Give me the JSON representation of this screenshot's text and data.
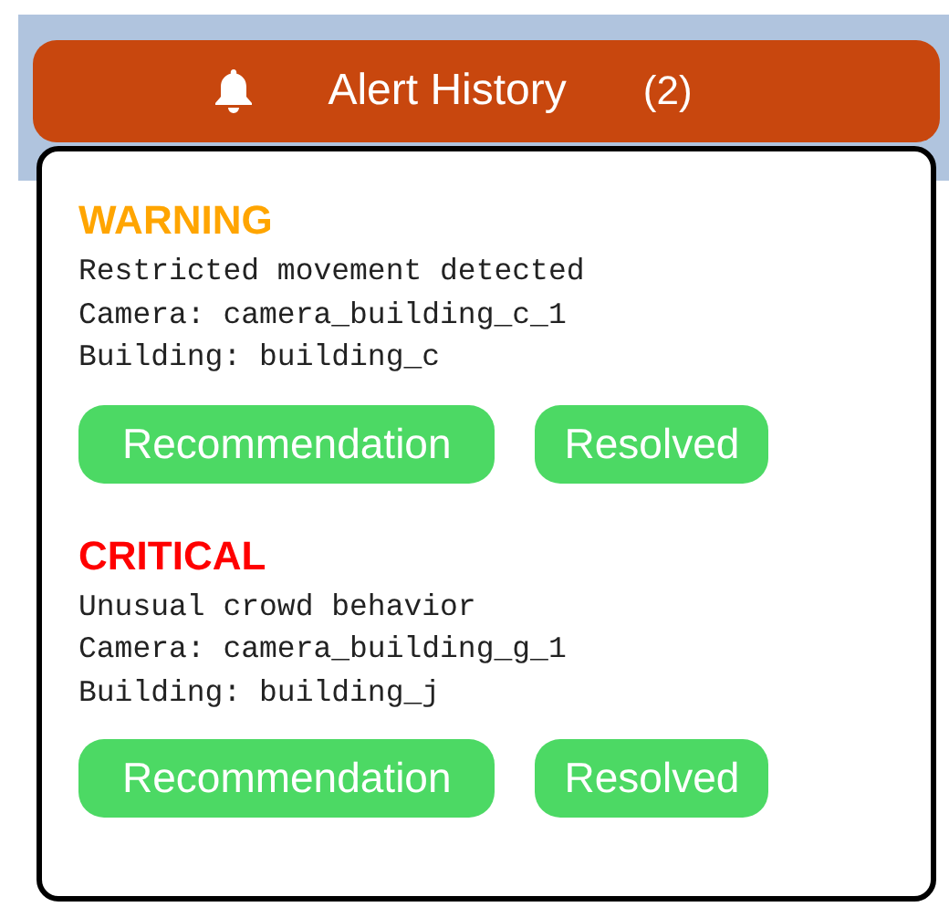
{
  "header": {
    "title": "Alert History",
    "count": "(2)"
  },
  "alerts": [
    {
      "severity": "WARNING",
      "kind": "warning",
      "message": "Restricted movement detected",
      "camera": "Camera: camera_building_c_1",
      "building": "Building: building_c",
      "buttons": [
        "Recommendation",
        "Resolved"
      ]
    },
    {
      "severity": "CRITICAL",
      "kind": "critical",
      "message": "Unusual crowd behavior",
      "camera": "Camera: camera_building_g_1",
      "building": "Building: building_j",
      "buttons": [
        "Recommendation",
        "Resolved"
      ]
    }
  ]
}
